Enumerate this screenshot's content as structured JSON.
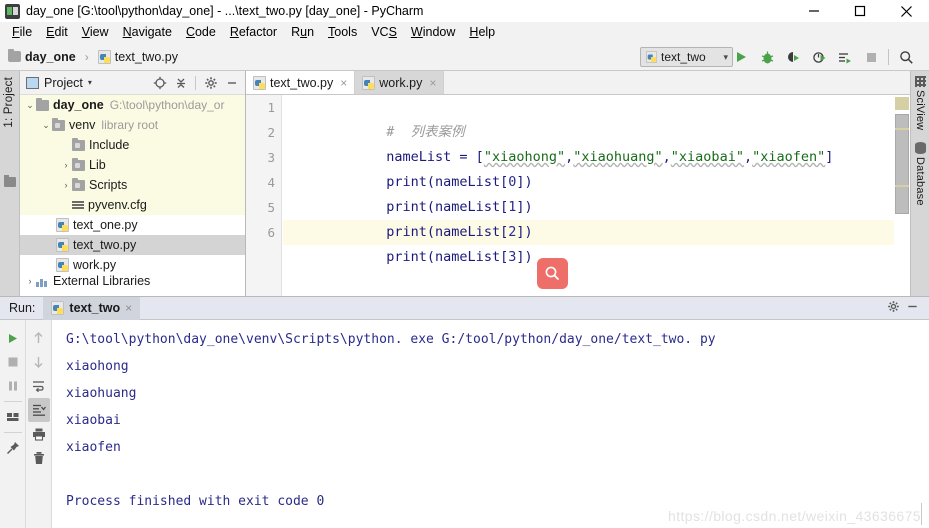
{
  "window": {
    "title": "day_one [G:\\tool\\python\\day_one] - ...\\text_two.py [day_one] - PyCharm",
    "app_icon": "pycharm-icon",
    "controls": {
      "minimize": "minimize-icon",
      "maximize": "maximize-icon",
      "close": "close-icon"
    }
  },
  "menubar": {
    "items": [
      {
        "label": "File",
        "mnemonic": "F"
      },
      {
        "label": "Edit",
        "mnemonic": "E"
      },
      {
        "label": "View",
        "mnemonic": "V"
      },
      {
        "label": "Navigate",
        "mnemonic": "N"
      },
      {
        "label": "Code",
        "mnemonic": "C"
      },
      {
        "label": "Refactor",
        "mnemonic": "R"
      },
      {
        "label": "Run",
        "mnemonic": "u"
      },
      {
        "label": "Tools",
        "mnemonic": "T"
      },
      {
        "label": "VCS",
        "mnemonic": "S"
      },
      {
        "label": "Window",
        "mnemonic": "W"
      },
      {
        "label": "Help",
        "mnemonic": "H"
      }
    ]
  },
  "navbar": {
    "breadcrumb": {
      "project": "day_one",
      "separator": "›",
      "file": "text_two.py"
    },
    "run_config": {
      "name": "text_two",
      "icon": "python-file-icon",
      "chevron": "▾"
    },
    "actions": [
      {
        "name": "run-button",
        "icon": "run-icon",
        "color": "#4aa24a"
      },
      {
        "name": "debug-button",
        "icon": "debug-icon",
        "color": "#4aa24a"
      },
      {
        "name": "run-coverage-button",
        "icon": "coverage-icon",
        "color": "#3c3c3c"
      },
      {
        "name": "profile-button",
        "icon": "profile-icon",
        "color": "#3c3c3c"
      },
      {
        "name": "run-with-console-button",
        "icon": "run-console-icon",
        "color": "#3c3c3c"
      },
      {
        "name": "stop-button",
        "icon": "stop-icon",
        "color": "#b0b0b0"
      },
      {
        "name": "search-everywhere-button",
        "icon": "search-icon",
        "color": "#3c3c3c"
      }
    ]
  },
  "left_strip": {
    "tab_label": "1: Project",
    "folder_icon": "folder-icon"
  },
  "project_panel": {
    "header": {
      "title": "Project",
      "chevron": "▾",
      "icon": "project-view-icon",
      "tools": [
        "locate-icon",
        "collapse-all-icon",
        "settings-gear-icon",
        "minimize-icon"
      ]
    },
    "tree": [
      {
        "arrow": "⌄",
        "icon": "folder-icon",
        "label": "day_one",
        "bold": true,
        "path": "G:\\tool\\python\\day_or",
        "indent": 0,
        "highlight": true
      },
      {
        "arrow": "⌄",
        "icon": "folder-module-icon",
        "label": "venv",
        "bold": false,
        "path": "library root",
        "indent": 1,
        "highlight": true
      },
      {
        "arrow": "",
        "icon": "folder-module-icon",
        "label": "Include",
        "bold": false,
        "path": "",
        "indent": 2,
        "highlight": true
      },
      {
        "arrow": "›",
        "icon": "folder-module-icon",
        "label": "Lib",
        "bold": false,
        "path": "",
        "indent": 2,
        "highlight": true
      },
      {
        "arrow": "›",
        "icon": "folder-module-icon",
        "label": "Scripts",
        "bold": false,
        "path": "",
        "indent": 2,
        "highlight": true
      },
      {
        "arrow": "",
        "icon": "config-file-icon",
        "label": "pyvenv.cfg",
        "bold": false,
        "path": "",
        "indent": 2,
        "highlight": true
      },
      {
        "arrow": "",
        "icon": "python-file-icon",
        "label": "text_one.py",
        "bold": false,
        "path": "",
        "indent": 1,
        "highlight": false
      },
      {
        "arrow": "",
        "icon": "python-file-icon",
        "label": "text_two.py",
        "bold": false,
        "path": "",
        "indent": 1,
        "highlight": false,
        "selected": true
      },
      {
        "arrow": "",
        "icon": "python-file-icon",
        "label": "work.py",
        "bold": false,
        "path": "",
        "indent": 1,
        "highlight": false
      },
      {
        "arrow": "›",
        "icon": "external-libraries-icon",
        "label": "External Libraries",
        "bold": false,
        "path": "",
        "indent": 0,
        "highlight": false
      }
    ]
  },
  "editor": {
    "tabs": [
      {
        "label": "text_two.py",
        "icon": "python-file-icon",
        "active": true,
        "close": "×"
      },
      {
        "label": "work.py",
        "icon": "python-file-icon",
        "active": false,
        "close": "×"
      }
    ],
    "lines": [
      {
        "num": "1",
        "text": "#  列表案例",
        "kind": "comment",
        "current": false
      },
      {
        "num": "2",
        "text": "nameList = [\"xiaohong\",\"xiaohuang\",\"xiaobai\",\"xiaofen\"]",
        "kind": "code",
        "current": false
      },
      {
        "num": "3",
        "text": "print(nameList[0])",
        "kind": "code",
        "current": false
      },
      {
        "num": "4",
        "text": "print(nameList[1])",
        "kind": "code",
        "current": false
      },
      {
        "num": "5",
        "text": "print(nameList[2])",
        "kind": "code",
        "current": false
      },
      {
        "num": "6",
        "text": "print(nameList[3])",
        "kind": "code",
        "current": true
      }
    ],
    "floating_search": {
      "icon": "search-icon",
      "color": "#ee6f69"
    }
  },
  "right_strip": {
    "items": [
      {
        "label": "SciView",
        "icon": "sciview-grid-icon"
      },
      {
        "label": "Database",
        "icon": "database-icon"
      }
    ]
  },
  "run_panel": {
    "label": "Run:",
    "tab": {
      "label": "text_two",
      "icon": "python-file-icon",
      "close": "×"
    },
    "header_actions": [
      "settings-gear-icon",
      "minimize-icon"
    ],
    "gutter_left": [
      {
        "name": "rerun-button",
        "icon": "run-icon"
      },
      {
        "name": "stop-button",
        "icon": "stop-icon"
      },
      {
        "name": "pause-button",
        "icon": "pause-icon"
      },
      {
        "name": "layout-button",
        "icon": "layout-icon"
      },
      {
        "name": "pin-tab-button",
        "icon": "pin-icon"
      }
    ],
    "gutter_right": [
      {
        "name": "up-button",
        "icon": "arrow-up-icon"
      },
      {
        "name": "down-button",
        "icon": "arrow-down-icon"
      },
      {
        "name": "soft-wrap-button",
        "icon": "soft-wrap-icon"
      },
      {
        "name": "scroll-to-end-button",
        "icon": "scroll-end-icon",
        "active": true
      },
      {
        "name": "print-button",
        "icon": "print-icon"
      },
      {
        "name": "clear-all-button",
        "icon": "trash-icon"
      }
    ],
    "console_lines": [
      "G:\\tool\\python\\day_one\\venv\\Scripts\\python. exe G:/tool/python/day_one/text_two. py",
      "xiaohong",
      "xiaohuang",
      "xiaobai",
      "xiaofen",
      "",
      "Process finished with exit code 0"
    ]
  },
  "watermark": {
    "text": "https://blog.csdn.net/weixin_43636675"
  },
  "colors": {
    "accent_green": "#4aa24a",
    "search_fab": "#ee6f69",
    "current_line": "#fdfae6",
    "tree_highlight": "#fbfbe3",
    "console_text": "#2b2b8c"
  }
}
